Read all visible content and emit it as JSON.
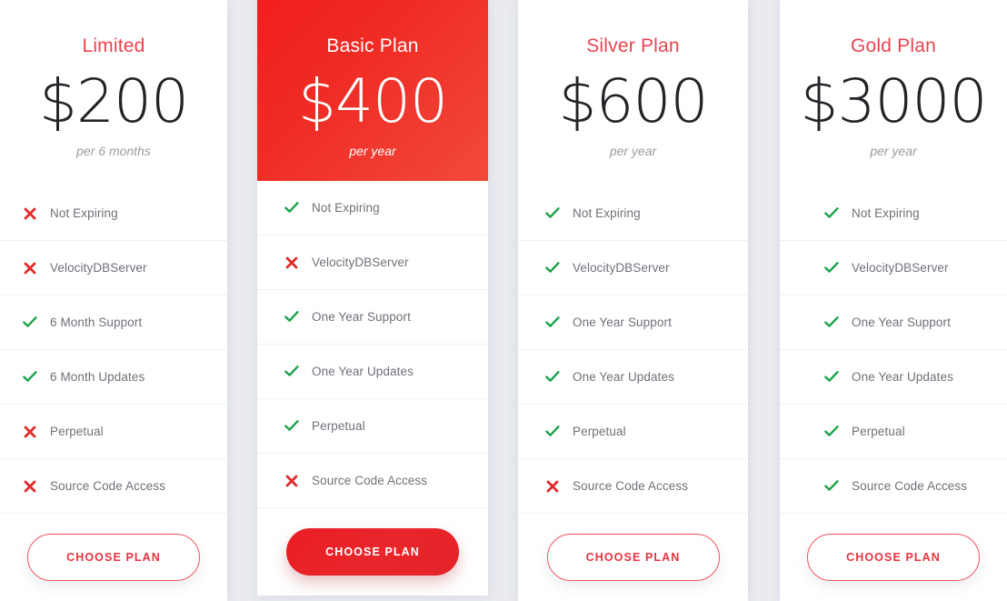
{
  "theme": {
    "page_background": "#e9ebf0",
    "card_background": "#ffffff",
    "accent_red": "#ea4350",
    "featured_red_start": "#f21f1f",
    "featured_red_end": "#f2493c",
    "check_green": "#1aa24a",
    "cross_red": "#e02b2b",
    "feature_text": "#6e7179",
    "price_text": "#222428",
    "period_text": "#9a9ca1"
  },
  "plans": [
    {
      "name": "Limited",
      "price": "$200",
      "period": "per 6 months",
      "featured": false,
      "cta": "CHOOSE PLAN",
      "features": [
        {
          "label": "Not Expiring",
          "included": false
        },
        {
          "label": "VelocityDBServer",
          "included": false
        },
        {
          "label": "6 Month Support",
          "included": true
        },
        {
          "label": "6 Month Updates",
          "included": true
        },
        {
          "label": "Perpetual",
          "included": false
        },
        {
          "label": "Source Code Access",
          "included": false
        }
      ]
    },
    {
      "name": "Basic Plan",
      "price": "$400",
      "period": "per year",
      "featured": true,
      "cta": "CHOOSE PLAN",
      "features": [
        {
          "label": "Not Expiring",
          "included": true
        },
        {
          "label": "VelocityDBServer",
          "included": false
        },
        {
          "label": "One Year Support",
          "included": true
        },
        {
          "label": "One Year Updates",
          "included": true
        },
        {
          "label": "Perpetual",
          "included": true
        },
        {
          "label": "Source Code Access",
          "included": false
        }
      ]
    },
    {
      "name": "Silver Plan",
      "price": "$600",
      "period": "per year",
      "featured": false,
      "cta": "CHOOSE PLAN",
      "features": [
        {
          "label": "Not Expiring",
          "included": true
        },
        {
          "label": "VelocityDBServer",
          "included": true
        },
        {
          "label": "One Year Support",
          "included": true
        },
        {
          "label": "One Year Updates",
          "included": true
        },
        {
          "label": "Perpetual",
          "included": true
        },
        {
          "label": "Source Code Access",
          "included": false
        }
      ]
    },
    {
      "name": "Gold Plan",
      "price": "$3000",
      "period": "per year",
      "featured": false,
      "cta": "CHOOSE PLAN",
      "features": [
        {
          "label": "Not Expiring",
          "included": true
        },
        {
          "label": "VelocityDBServer",
          "included": true
        },
        {
          "label": "One Year Support",
          "included": true
        },
        {
          "label": "One Year Updates",
          "included": true
        },
        {
          "label": "Perpetual",
          "included": true
        },
        {
          "label": "Source Code Access",
          "included": true
        }
      ]
    }
  ],
  "icons": {
    "check": "check-icon",
    "cross": "cross-icon"
  }
}
